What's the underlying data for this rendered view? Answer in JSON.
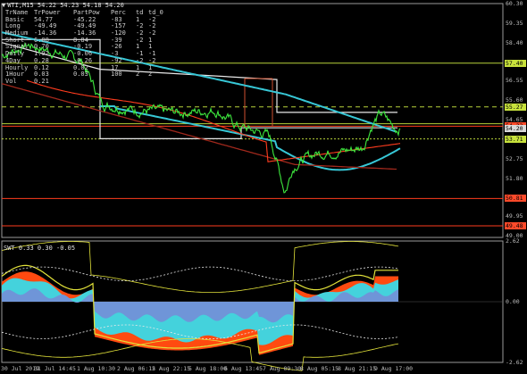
{
  "window": {
    "title": "WTI,M15  54.22 54.23 54.18 54.20"
  },
  "stats_table": {
    "headers": [
      "TrName",
      "TrPower",
      "PartPow",
      "Perc",
      "td",
      "td_0"
    ],
    "rows": [
      [
        "Basic",
        "54.77",
        "-45.22",
        "-83",
        "1",
        "-2"
      ],
      [
        "Long",
        "-49.49",
        "-49.49",
        "-157",
        "-2",
        "-2"
      ],
      [
        "Medium",
        "-14.36",
        "-14.36",
        "-120",
        "-2",
        "-2"
      ],
      [
        "Short",
        "6.08",
        "8.84",
        "-39",
        "-2",
        "1"
      ],
      [
        "Signal",
        "0.70",
        "-0.19",
        "-26",
        "1",
        "1"
      ],
      [
        "Daily",
        "1.92",
        "-0.06",
        "-3",
        "-1",
        "-1"
      ],
      [
        "4Day",
        "0.28",
        "-0.26",
        "-92",
        "-2",
        "-2"
      ],
      [
        "Hourly",
        "0.12",
        "0.02",
        "17",
        "1",
        "1"
      ],
      [
        "1Hour",
        "0.03",
        "0.03",
        "100",
        "2",
        "2"
      ],
      [
        "Vol",
        "0.21",
        "",
        "",
        "",
        ""
      ]
    ]
  },
  "price_axis": {
    "labels": [
      "60.30",
      "59.35",
      "58.40",
      "57.45",
      "56.55",
      "55.60",
      "54.65",
      "53.70",
      "52.75",
      "51.80",
      "50.85",
      "49.95",
      "49.00"
    ]
  },
  "price_tags": [
    {
      "value": "57.40",
      "bg": "#c8e23c"
    },
    {
      "value": "55.27",
      "bg": "#c8e23c"
    },
    {
      "value": "54.33",
      "bg": "#ff4a2a"
    },
    {
      "value": "54.20",
      "bg": "#d9d9d9"
    },
    {
      "value": "53.71",
      "bg": "#c8e23c"
    },
    {
      "value": "50.81",
      "bg": "#ff4a2a"
    },
    {
      "value": "49.48",
      "bg": "#ff4a2a"
    }
  ],
  "indicator": {
    "title": "SWT 0.33 0.30 -0.05",
    "axis_labels": [
      "2.62",
      "0.00",
      "-2.62"
    ]
  },
  "time_axis": {
    "labels": [
      "30 Jul 2019",
      "31 Jul 14:45",
      "1 Aug 10:30",
      "2 Aug 06:15",
      "2 Aug 22:15",
      "5 Aug 18:00",
      "6 Aug 13:45",
      "7 Aug 09:30",
      "8 Aug 05:15",
      "8 Aug 21:15",
      "9 Aug 17:00"
    ]
  },
  "colors": {
    "price_line": "#3ee83e",
    "cyan_band": "#37c7d6",
    "red_line": "#ff3c1e",
    "dark_red_line": "#a0281c",
    "white_line": "#e8e8e8",
    "yellow_line": "#e2e23a",
    "olive_level": "#b7d23a",
    "hist_orange": "#ff4a10",
    "hist_cyan": "#44d2dc",
    "hist_blue": "#6f95d8"
  }
}
